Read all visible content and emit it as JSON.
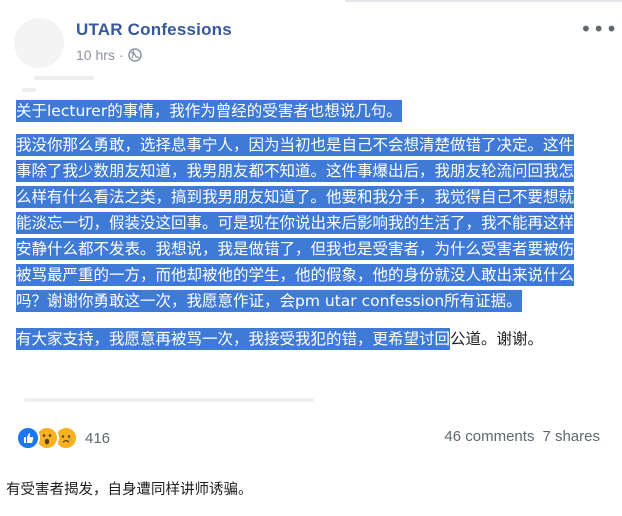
{
  "post": {
    "page_name": "UTAR Confessions",
    "time": "10 hrs",
    "time_separator": "·",
    "more_icon": "more-horizontal-icon",
    "privacy_icon": "globe-icon",
    "paragraphs": [
      {
        "highlighted": "关于lecturer的事情，我作为曾经的受害者也想说几句。",
        "plain": ""
      },
      {
        "highlighted": "我没你那么勇敢，选择息事宁人，因为当初也是自己不会想清楚做错了决定。这件事除了我少数朋友知道，我男朋友都不知道。这件事爆出后，我朋友轮流问回我怎么样有什么看法之类，搞到我男朋友知道了。他要和我分手，我觉得自己不要想就能淡忘一切，假装没这回事。可是现在你说出来后影响我的生活了，我不能再这样安静什么都不发表。我想说，我是做错了，但我也是受害者，为什么受害者要被伤被骂最严重的一方，而他却被他的学生，他的假象，他的身份就没人敢出来说什么吗？谢谢你勇敢这一次，我愿意作证，会pm utar confession所有证据。",
        "plain": ""
      },
      {
        "highlighted": "有大家支持，我愿意再被骂一次，我接受我犯的错，更希望讨回",
        "plain": "公道。谢谢。"
      }
    ],
    "highlight_color": "#3e7ad6",
    "link_color": "#385898"
  },
  "footer": {
    "reaction_icons": [
      "like-icon",
      "wow-icon",
      "sad-icon"
    ],
    "reaction_count": "416",
    "comments": "46 comments",
    "shares": "7 shares"
  },
  "caption": "有受害者揭发，自身遭同样讲师诱骗。"
}
